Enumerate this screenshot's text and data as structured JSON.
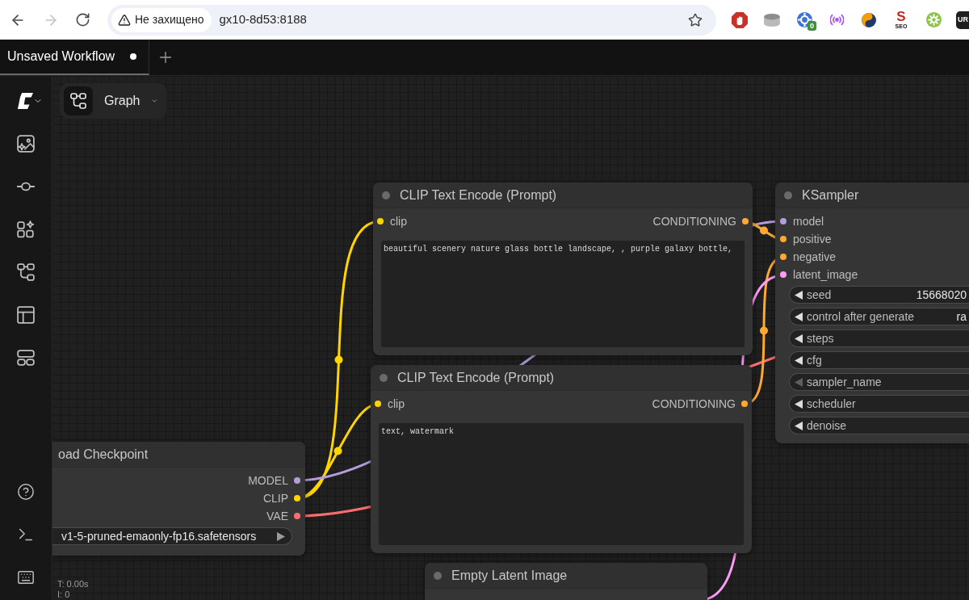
{
  "browser": {
    "back_disabled": false,
    "forward_disabled": true,
    "security_label": "Не захищено",
    "url": "gx10-8d53:8188",
    "extensions": [
      {
        "kind": "blocker"
      },
      {
        "kind": "cylinder"
      },
      {
        "kind": "target",
        "badge": "0"
      },
      {
        "kind": "broadcast"
      },
      {
        "kind": "swirl"
      },
      {
        "kind": "letter",
        "letter": "S",
        "badge": "SEO"
      },
      {
        "kind": "gear"
      },
      {
        "kind": "tile",
        "label": "UR"
      }
    ]
  },
  "tabs": [
    {
      "label": "Unsaved Workflow",
      "selected": true,
      "modified": true
    }
  ],
  "graph_menu": {
    "label": "Graph"
  },
  "nodes": [
    {
      "kind": "text_encode",
      "title": "CLIP Text Encode (Prompt)",
      "inputs": [
        {
          "name": "clip",
          "color": "#ffd500"
        }
      ],
      "outputs": [
        {
          "name": "CONDITIONING",
          "color": "#ffa931"
        }
      ],
      "text": "beautiful scenery nature glass bottle landscape, , purple galaxy bottle,"
    },
    {
      "kind": "sampler",
      "title": "KSampler",
      "inputs": [
        {
          "name": "model",
          "color": "#b39ddb"
        },
        {
          "name": "positive",
          "color": "#ffa931"
        },
        {
          "name": "negative",
          "color": "#ffa931"
        },
        {
          "name": "latent_image",
          "color": "#ff9cf9"
        }
      ],
      "widgets": [
        {
          "label": "seed",
          "value": "15668020",
          "at_start": false
        },
        {
          "label": "control after generate",
          "value": "ra",
          "at_start": false
        },
        {
          "label": "steps",
          "at_start": false
        },
        {
          "label": "cfg",
          "at_start": false
        },
        {
          "label": "sampler_name",
          "at_start": true
        },
        {
          "label": "scheduler",
          "at_start": false
        },
        {
          "label": "denoise",
          "at_start": false
        }
      ]
    },
    {
      "kind": "text_encode",
      "title": "CLIP Text Encode (Prompt)",
      "inputs": [
        {
          "name": "clip",
          "color": "#ffd500"
        }
      ],
      "outputs": [
        {
          "name": "CONDITIONING",
          "color": "#ffa931"
        }
      ],
      "text": "text, watermark"
    },
    {
      "kind": "checkpoint",
      "title": "oad Checkpoint",
      "outputs": [
        {
          "name": "MODEL",
          "color": "#b39ddb"
        },
        {
          "name": "CLIP",
          "color": "#ffd500"
        },
        {
          "name": "VAE",
          "color": "#ff6e6e"
        }
      ],
      "widgets": [
        {
          "value": "v1-5-pruned-emaonly-fp16.safetensors"
        }
      ]
    },
    {
      "kind": "latent",
      "title": "Empty Latent Image"
    }
  ],
  "stats": [
    "T: 0.00s",
    "I: 0"
  ]
}
